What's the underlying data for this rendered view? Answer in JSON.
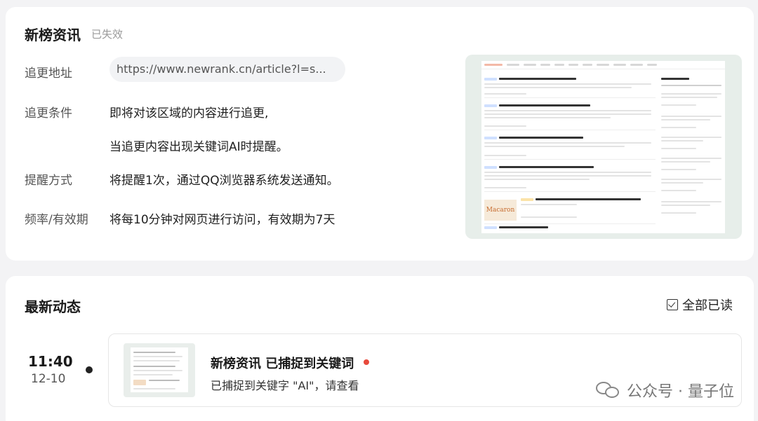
{
  "monitor": {
    "title": "新榜资讯",
    "status": "已失效",
    "rows": [
      {
        "label": "追更地址",
        "value": "https://www.newrank.cn/article?l=s..."
      },
      {
        "label": "追更条件",
        "value": "即将对该区域的内容进行追更,",
        "value2": "当追更内容出现关键词AI时提醒。"
      },
      {
        "label": "提醒方式",
        "value": "将提醒1次，通过QQ浏览器系统发送通知。"
      },
      {
        "label": "频率/有效期",
        "value": "将每10分钟对网页进行访问，有效期为7天"
      }
    ],
    "thumbnail": {
      "badge_text": "Macaron"
    }
  },
  "activity": {
    "title": "最新动态",
    "mark_all_read": "全部已读",
    "check_icon": "check-square-icon",
    "items": [
      {
        "time": "11:40",
        "date": "12-10",
        "title": "新榜资讯 已捕捉到关键词",
        "subtitle": "已捕捉到关键字 \"AI\"，请查看",
        "unread_color": "#e84a3c"
      }
    ]
  },
  "watermark": {
    "text": "公众号 · 量子位",
    "icon": "wechat-icon"
  }
}
